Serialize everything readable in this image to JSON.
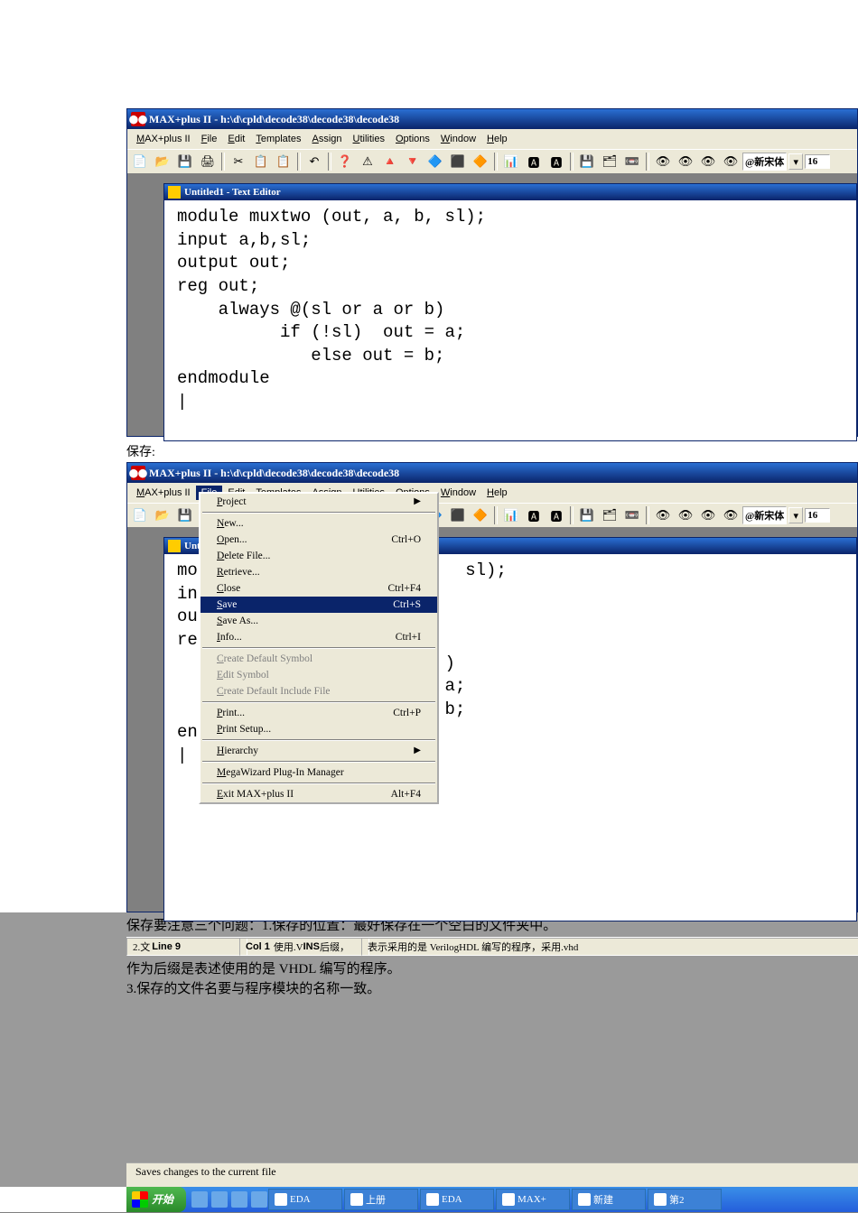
{
  "app_title": "MAX+plus II - h:\\d\\cpld\\decode38\\decode38\\decode38",
  "menus": [
    "MAX+plus II",
    "File",
    "Edit",
    "Templates",
    "Assign",
    "Utilities",
    "Options",
    "Window",
    "Help"
  ],
  "menu_u": [
    "M",
    "F",
    "E",
    "T",
    "A",
    "U",
    "O",
    "W",
    "H"
  ],
  "sub_window_title": "Untitled1 - Text Editor",
  "sub_window_title2": "Unt",
  "font_label": "@新宋体",
  "font_size": "16",
  "code_lines": [
    "module muxtwo (out, a, b, sl);",
    "input a,b,sl;",
    "output out;",
    "reg out;",
    "    always @(sl or a or b)",
    "          if (!sl)  out = a;",
    "             else out = b;",
    "endmodule",
    "|"
  ],
  "code2_visible": [
    "mo                          sl);",
    "in",
    "ou",
    "re",
    "                          )",
    "                        = a;",
    "                          b;",
    "en",
    "|"
  ],
  "save_caption": "保存:",
  "file_menu": [
    {
      "label": "Project",
      "arrow": true
    },
    {
      "sep": true
    },
    {
      "label": "New..."
    },
    {
      "label": "Open...",
      "shortcut": "Ctrl+O"
    },
    {
      "label": "Delete File..."
    },
    {
      "label": "Retrieve..."
    },
    {
      "label": "Close",
      "shortcut": "Ctrl+F4"
    },
    {
      "label": "Save",
      "shortcut": "Ctrl+S",
      "highlight": true
    },
    {
      "label": "Save As..."
    },
    {
      "label": "Info...",
      "shortcut": "Ctrl+I"
    },
    {
      "sep": true
    },
    {
      "label": "Create Default Symbol",
      "disabled": true
    },
    {
      "label": "Edit Symbol",
      "disabled": true
    },
    {
      "label": "Create Default Include File",
      "disabled": true
    },
    {
      "sep": true
    },
    {
      "label": "Print...",
      "shortcut": "Ctrl+P"
    },
    {
      "label": "Print Setup..."
    },
    {
      "sep": true
    },
    {
      "label": "Hierarchy",
      "arrow": true
    },
    {
      "sep": true
    },
    {
      "label": "MegaWizard Plug-In Manager"
    },
    {
      "sep": true
    },
    {
      "label": "Exit MAX+plus II",
      "shortcut": "Alt+F4"
    }
  ],
  "status_line": {
    "line": "Line  9",
    "col": "Col  1",
    "ins": "INS"
  },
  "notes": [
    "保存要注意三个问题：1.保存的位置：最好保存在一个空白的文件夹中。",
    "2.文件的后缀：使用.V作为后缀，表示采用的是 VerilogHDL 编写的程序，采用.vhd",
    "作为后缀是表述使用的是 VHDL 编写的程序。",
    "3.保存的文件名要与程序模块的名称一致。"
  ],
  "status_wide": "Saves changes to the current file",
  "start": "开始",
  "tasks": [
    "EDA",
    "上册",
    "EDA",
    "MAX+",
    "新建",
    "第2"
  ],
  "toolbar_icons": [
    "📄",
    "📂",
    "💾",
    "🖨",
    "",
    "✂",
    "📋",
    "📋",
    "",
    "↶",
    "",
    "❓",
    "⚠",
    "🔺",
    "🔻",
    "🔷",
    "⬛",
    "🔶",
    "",
    "📊",
    "🅰",
    "🅰",
    "",
    "💾",
    "🗂",
    "📼",
    "",
    "👁",
    "👁",
    "👁",
    "👁"
  ]
}
